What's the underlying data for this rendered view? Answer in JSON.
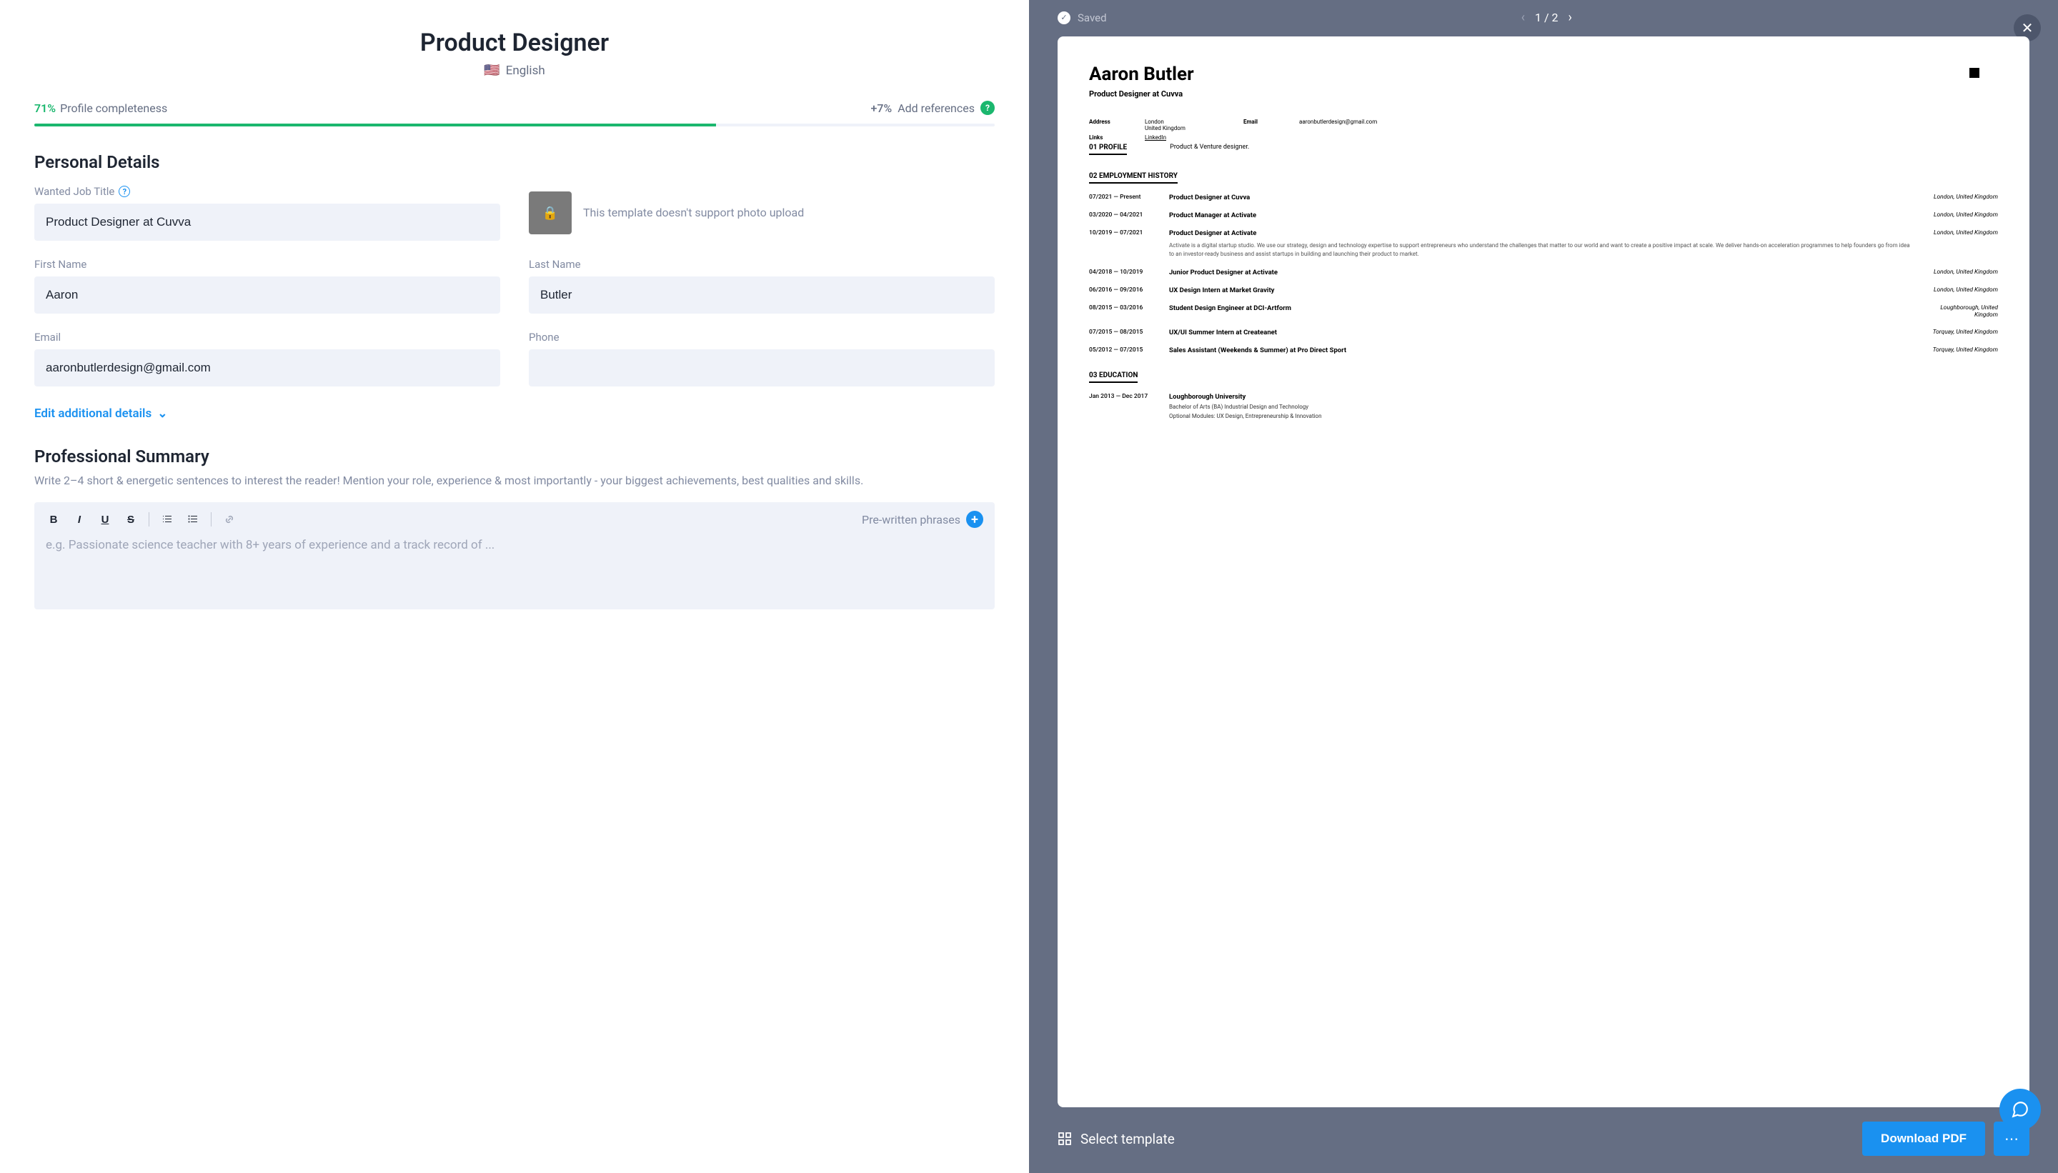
{
  "header": {
    "title": "Product Designer",
    "language": "English"
  },
  "progress": {
    "percent": "71%",
    "label": "Profile completeness",
    "bonus": "+7%",
    "bonus_label": "Add references",
    "fill_width": "71%"
  },
  "sections": {
    "personal": {
      "title": "Personal Details",
      "job_title_label": "Wanted Job Title",
      "job_title_value": "Product Designer at Cuvva",
      "photo_note": "This template doesn't support photo upload",
      "first_name_label": "First Name",
      "first_name_value": "Aaron",
      "last_name_label": "Last Name",
      "last_name_value": "Butler",
      "email_label": "Email",
      "email_value": "aaronbutlerdesign@gmail.com",
      "phone_label": "Phone",
      "phone_value": "",
      "edit_link": "Edit additional details"
    },
    "summary": {
      "title": "Professional Summary",
      "subtext": "Write 2–4 short & energetic sentences to interest the reader! Mention your role, experience & most importantly - your biggest achievements, best qualities and skills.",
      "phrases": "Pre-written phrases",
      "placeholder": "e.g. Passionate science teacher with 8+ years of experience and a track record of ..."
    }
  },
  "preview": {
    "saved": "Saved",
    "page": "1 / 2",
    "select_template": "Select template",
    "download": "Download PDF"
  },
  "doc": {
    "name": "Aaron Butler",
    "role": "Product Designer at Cuvva",
    "address_label": "Address",
    "address_1": "London",
    "address_2": "United Kingdom",
    "email_label": "Email",
    "email": "aaronbutlerdesign@gmail.com",
    "links_label": "Links",
    "links": "LinkedIn",
    "s1": "01  PROFILE",
    "s1_text": "Product & Venture designer.",
    "s2": "02  EMPLOYMENT HISTORY",
    "s3": "03  EDUCATION",
    "jobs": [
      {
        "date": "07/2021 — Present",
        "title": "Product Designer at Cuvva",
        "loc": "London, United Kingdom"
      },
      {
        "date": "03/2020 — 04/2021",
        "title": "Product Manager at Activate",
        "loc": "London, United Kingdom"
      },
      {
        "date": "10/2019 — 07/2021",
        "title": "Product Designer at Activate",
        "loc": "London, United Kingdom",
        "desc": "Activate is a digital startup studio. We use our strategy, design and technology expertise to support entrepreneurs who understand the challenges that matter to our world and want to create a positive impact at scale.  We deliver hands-on acceleration programmes to help founders go from idea to an investor-ready business and assist startups in building and launching their product to market."
      },
      {
        "date": "04/2018 — 10/2019",
        "title": "Junior Product Designer at Activate",
        "loc": "London, United Kingdom"
      },
      {
        "date": "06/2016 — 09/2016",
        "title": "UX Design Intern at Market Gravity",
        "loc": "London, United Kingdom"
      },
      {
        "date": "08/2015 — 03/2016",
        "title": "Student Design Engineer at DCI-Artform",
        "loc": "Loughborough, United Kingdom"
      },
      {
        "date": "07/2015 — 08/2015",
        "title": "UX/UI Summer Intern at Createanet",
        "loc": "Torquay, United Kingdom"
      },
      {
        "date": "05/2012 — 07/2015",
        "title": "Sales Assistant (Weekends & Summer) at Pro Direct Sport",
        "loc": "Torquay, United Kingdom"
      }
    ],
    "edu": {
      "date": "Jan 2013 — Dec 2017",
      "title": "Loughborough University",
      "sub1": "Bachelor of Arts (BA) Industrial Design and Technology",
      "sub2": "Optional Modules: UX Design, Entrepreneurship & Innovation"
    }
  }
}
